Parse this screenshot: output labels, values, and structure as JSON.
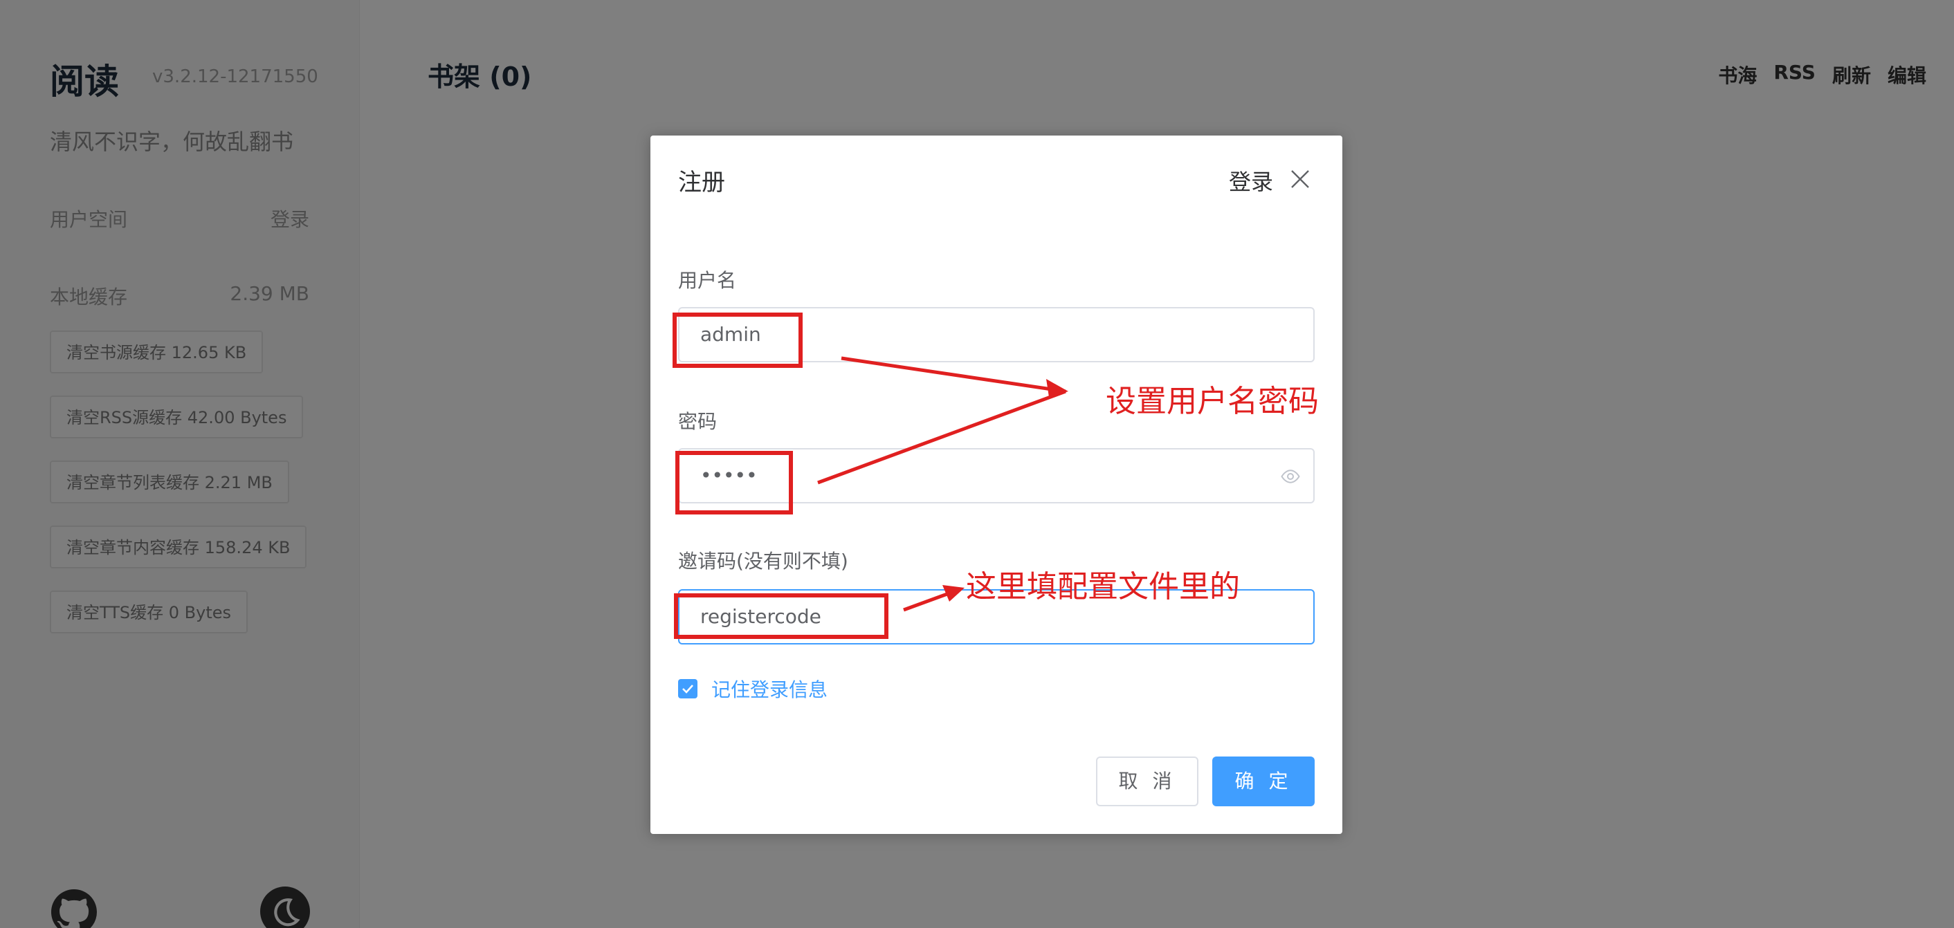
{
  "sidebar": {
    "app_name": "阅读",
    "version": "v3.2.12-12171550",
    "slogan": "清风不识字，何故乱翻书",
    "user_space_label": "用户空间",
    "login_link": "登录",
    "cache_label": "本地缓存",
    "cache_size": "2.39 MB",
    "cache_buttons": [
      "清空书源缓存 12.65 KB",
      "清空RSS源缓存 42.00 Bytes",
      "清空章节列表缓存 2.21 MB",
      "清空章节内容缓存 158.24 KB",
      "清空TTS缓存 0 Bytes"
    ],
    "github_icon": "github-icon",
    "theme_icon": "moon-icon"
  },
  "main": {
    "title": "书架 (0)",
    "nav": [
      "书海",
      "RSS",
      "刷新",
      "编辑"
    ]
  },
  "dialog": {
    "title": "注册",
    "switch_login": "登录",
    "close_icon": "close-icon",
    "username_label": "用户名",
    "username_value": "admin",
    "password_label": "密码",
    "password_value": "•••••",
    "invite_label": "邀请码(没有则不填)",
    "invite_value": "registercode",
    "remember_label": "记住登录信息",
    "remember_checked": true,
    "cancel": "取 消",
    "confirm": "确 定"
  },
  "annotations": {
    "note_credentials": "设置用户名密码",
    "note_invite": "这里填配置文件里的"
  },
  "colors": {
    "primary": "#409eff",
    "annotation": "#e02020",
    "overlay": "rgba(0,0,0,0.5)"
  }
}
